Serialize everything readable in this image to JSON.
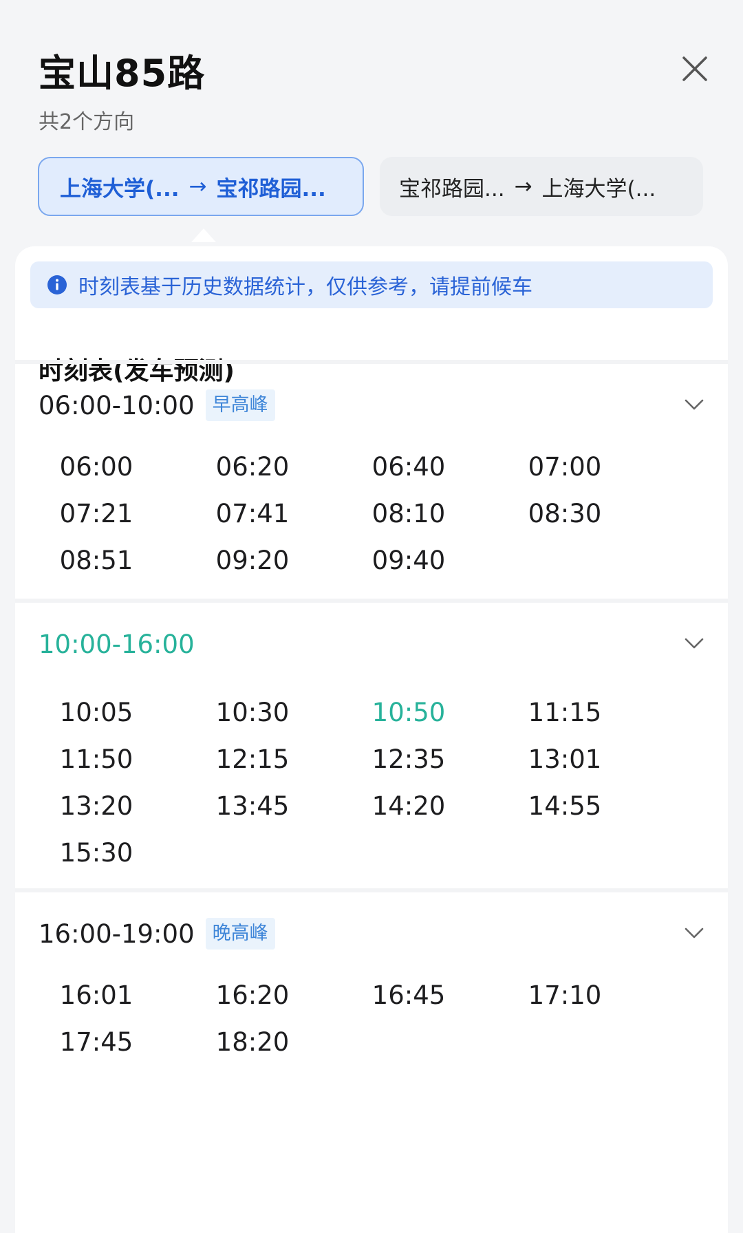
{
  "header": {
    "title": "宝山85路",
    "subtitle": "共2个方向",
    "close_icon": "close-icon"
  },
  "directions": [
    {
      "from": "上海大学(...",
      "arrow": "→",
      "to": "宝祁路园...",
      "active": true
    },
    {
      "from": "宝祁路园...",
      "arrow": "→",
      "to": "上海大学(...",
      "active": false
    }
  ],
  "notice": {
    "icon": "info-icon",
    "text": "时刻表基于历史数据统计，仅供参考，请提前候车"
  },
  "schedule_title": "时刻表(发车预测)",
  "colors": {
    "accent_blue": "#1f5fd6",
    "current_green": "#27b29a",
    "tag_blue": "#3f86d8"
  },
  "sections": [
    {
      "range": "06:00-10:00",
      "tag": "早高峰",
      "current": false,
      "times": [
        "06:00",
        "06:20",
        "06:40",
        "07:00",
        "07:21",
        "07:41",
        "08:10",
        "08:30",
        "08:51",
        "09:20",
        "09:40"
      ]
    },
    {
      "range": "10:00-16:00",
      "tag": "",
      "current": true,
      "current_time": "10:50",
      "times": [
        "10:05",
        "10:30",
        "10:50",
        "11:15",
        "11:50",
        "12:15",
        "12:35",
        "13:01",
        "13:20",
        "13:45",
        "14:20",
        "14:55",
        "15:30"
      ]
    },
    {
      "range": "16:00-19:00",
      "tag": "晚高峰",
      "current": false,
      "times": [
        "16:01",
        "16:20",
        "16:45",
        "17:10",
        "17:45",
        "18:20"
      ]
    }
  ]
}
